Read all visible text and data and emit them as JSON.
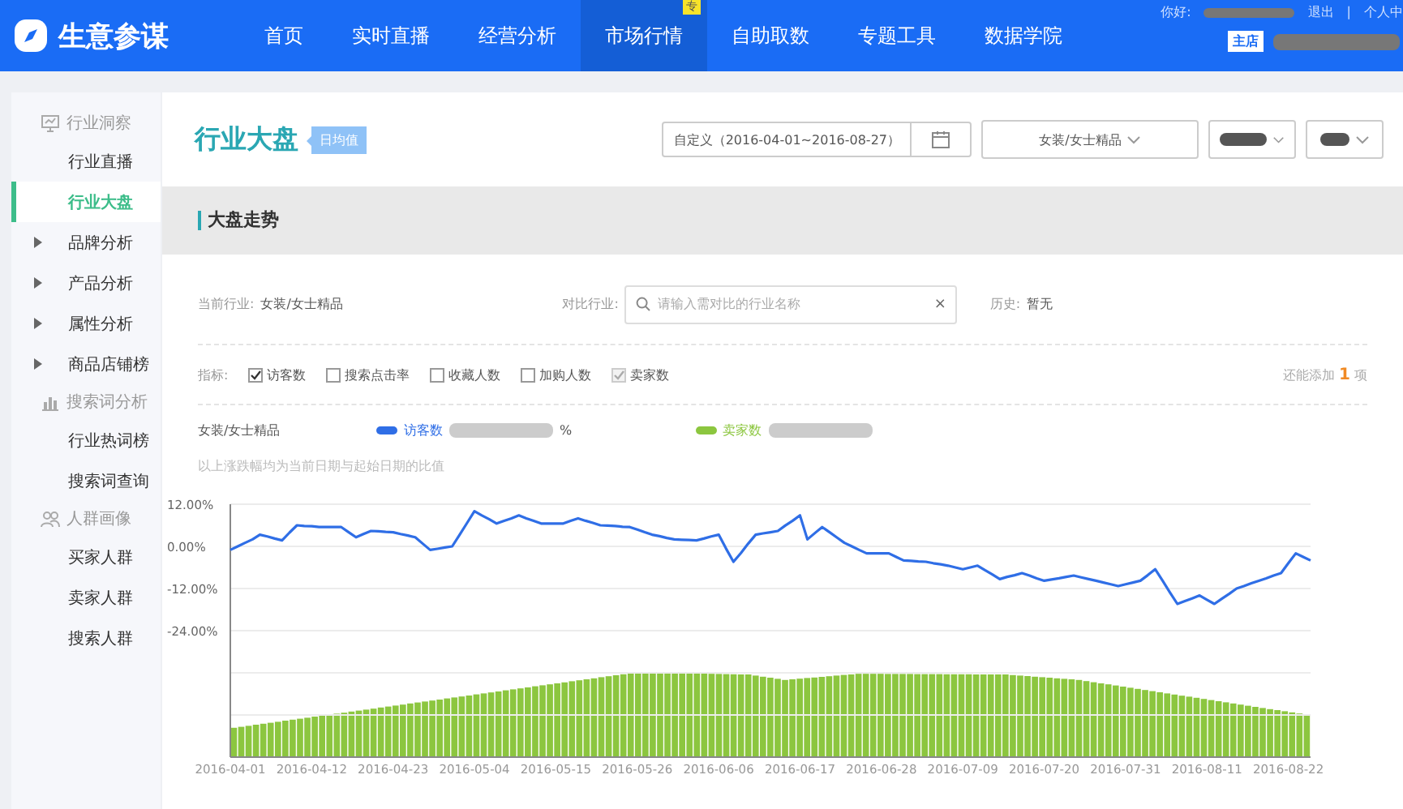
{
  "topbar": {
    "logo": "生意参谋",
    "nav": [
      {
        "label": "首页",
        "selected": false
      },
      {
        "label": "实时直播",
        "selected": false
      },
      {
        "label": "经营分析",
        "selected": false
      },
      {
        "label": "市场行情",
        "selected": true,
        "badge": "专"
      },
      {
        "label": "自助取数",
        "selected": false
      },
      {
        "label": "专题工具",
        "selected": false
      },
      {
        "label": "数据学院",
        "selected": false
      }
    ],
    "greeting": "你好:",
    "logout": "退出",
    "separator": "|",
    "profile": "个人中",
    "shop_tag": "主店"
  },
  "sidebar": {
    "groups": [
      {
        "title": "行业洞察",
        "items": [
          {
            "label": "行业直播",
            "kind": "leaf",
            "selected": false
          },
          {
            "label": "行业大盘",
            "kind": "leaf",
            "selected": true
          },
          {
            "label": "品牌分析",
            "kind": "folder",
            "selected": false
          },
          {
            "label": "产品分析",
            "kind": "folder",
            "selected": false
          },
          {
            "label": "属性分析",
            "kind": "folder",
            "selected": false
          },
          {
            "label": "商品店铺榜",
            "kind": "folder",
            "selected": false
          }
        ]
      },
      {
        "title": "搜索词分析",
        "items": [
          {
            "label": "行业热词榜",
            "kind": "leaf",
            "selected": false
          },
          {
            "label": "搜索词查询",
            "kind": "leaf",
            "selected": false
          }
        ]
      },
      {
        "title": "人群画像",
        "items": [
          {
            "label": "买家人群",
            "kind": "leaf",
            "selected": false
          },
          {
            "label": "卖家人群",
            "kind": "leaf",
            "selected": false
          },
          {
            "label": "搜索人群",
            "kind": "leaf",
            "selected": false
          }
        ]
      }
    ]
  },
  "header": {
    "title": "行业大盘",
    "tag": "日均值",
    "date_range": "自定义（2016-04-01~2016-08-27）",
    "category": "女装/女士精品"
  },
  "section": {
    "title": "大盘走势"
  },
  "filters": {
    "current_label": "当前行业:",
    "current_value": "女装/女士精品",
    "compare_label": "对比行业:",
    "compare_placeholder": "请输入需对比的行业名称",
    "clear_glyph": "×",
    "history_label": "历史:",
    "history_value": "暂无"
  },
  "indicators": {
    "label": "指标:",
    "items": [
      {
        "label": "访客数",
        "checked": true,
        "disabled": false
      },
      {
        "label": "搜索点击率",
        "checked": false,
        "disabled": false
      },
      {
        "label": "收藏人数",
        "checked": false,
        "disabled": false
      },
      {
        "label": "加购人数",
        "checked": false,
        "disabled": false
      },
      {
        "label": "卖家数",
        "checked": true,
        "disabled": true
      }
    ],
    "remaining_prefix": "还能添加",
    "remaining_count": "1",
    "remaining_suffix": "项"
  },
  "legend": {
    "category": "女装/女士精品",
    "items": [
      {
        "kind": "series",
        "suffix": "%"
      },
      {
        "kind": "static",
        "label": "卖家数",
        "color": "#8cc63f"
      }
    ]
  },
  "note": "以上涨跌幅均为当前日期与起始日期的比值",
  "chart_data": {
    "type": "line",
    "categories": [
      "2016-04-01",
      null,
      null,
      null,
      null,
      null,
      null,
      null,
      null,
      null,
      null,
      "2016-04-12",
      null,
      null,
      null,
      null,
      null,
      null,
      null,
      null,
      null,
      null,
      "2016-04-23",
      null,
      null,
      null,
      null,
      null,
      null,
      null,
      null,
      null,
      null,
      "2016-05-04",
      null,
      null,
      null,
      null,
      null,
      null,
      null,
      null,
      null,
      null,
      "2016-05-15",
      null,
      null,
      null,
      null,
      null,
      null,
      null,
      null,
      null,
      null,
      "2016-05-26",
      null,
      null,
      null,
      null,
      null,
      null,
      null,
      null,
      null,
      null,
      "2016-06-06",
      null,
      null,
      null,
      null,
      null,
      null,
      null,
      null,
      null,
      null,
      "2016-06-17",
      null,
      null,
      null,
      null,
      null,
      null,
      null,
      null,
      null,
      null,
      "2016-06-28",
      null,
      null,
      null,
      null,
      null,
      null,
      null,
      null,
      null,
      null,
      "2016-07-09",
      null,
      null,
      null,
      null,
      null,
      null,
      null,
      null,
      null,
      null,
      "2016-07-20",
      null,
      null,
      null,
      null,
      null,
      null,
      null,
      null,
      null,
      null,
      "2016-07-31",
      null,
      null,
      null,
      null,
      null,
      null,
      null,
      null,
      null,
      null,
      "2016-08-11",
      null,
      null,
      null,
      null,
      null,
      null,
      null,
      null,
      null,
      null,
      "2016-08-22",
      null,
      null,
      null
    ],
    "series": [
      {
        "name": "访客数",
        "color": "#2f6ee6",
        "values": [
          -1,
          0,
          1,
          2,
          3.3,
          2.8,
          2.2,
          1.7,
          3.9,
          6,
          5.8,
          5.7,
          5.5,
          5.5,
          5.5,
          5.5,
          4,
          2.6,
          3.5,
          4.4,
          4.3,
          4.1,
          4,
          3.5,
          3.1,
          2.6,
          0.8,
          -1,
          -0.7,
          -0.3,
          0,
          3.3,
          6.7,
          10,
          8.8,
          7.7,
          6.5,
          7.3,
          8,
          8.8,
          8,
          7.3,
          6.5,
          6.5,
          6.5,
          6.5,
          7.3,
          8,
          7.3,
          6.7,
          6,
          5.9,
          5.8,
          5.6,
          5.5,
          4.8,
          4,
          3.3,
          2.9,
          2.4,
          2,
          1.9,
          1.8,
          1.7,
          2.2,
          2.8,
          3.3,
          -0.6,
          -4.4,
          -1.9,
          0.8,
          3.3,
          3.7,
          4,
          4.4,
          5.9,
          7.3,
          8.8,
          2,
          3.8,
          5.5,
          4,
          2.5,
          1,
          0,
          -1,
          -2,
          -2,
          -2,
          -2,
          -3,
          -4,
          -4.1,
          -4.3,
          -4.4,
          -4.8,
          -5.1,
          -5.5,
          -6,
          -6.5,
          -6,
          -5.5,
          -6.8,
          -8,
          -9.3,
          -8.7,
          -8.2,
          -7.6,
          -8.3,
          -9.1,
          -9.8,
          -9.4,
          -9.1,
          -8.7,
          -8.3,
          -8.8,
          -9.3,
          -9.8,
          -10.3,
          -10.8,
          -11.3,
          -10.8,
          -10.3,
          -9.8,
          -8.2,
          -6.5,
          -9.8,
          -13.1,
          -16.4,
          -15.6,
          -14.8,
          -14,
          -15.2,
          -16.4,
          -14.9,
          -13.5,
          -12,
          -11.3,
          -10.5,
          -9.8,
          -9.1,
          -8.3,
          -7.6,
          -4.8,
          -2,
          -3,
          -4
        ]
      }
    ],
    "grid": true,
    "ylim": [
      -60,
      12
    ],
    "yticks": [
      {
        "value": -24,
        "label": "-24.00%"
      },
      {
        "value": -12,
        "label": "-12.00%"
      },
      {
        "value": 0,
        "label": "0.00%"
      },
      {
        "value": 12,
        "label": "12.00%"
      }
    ]
  }
}
